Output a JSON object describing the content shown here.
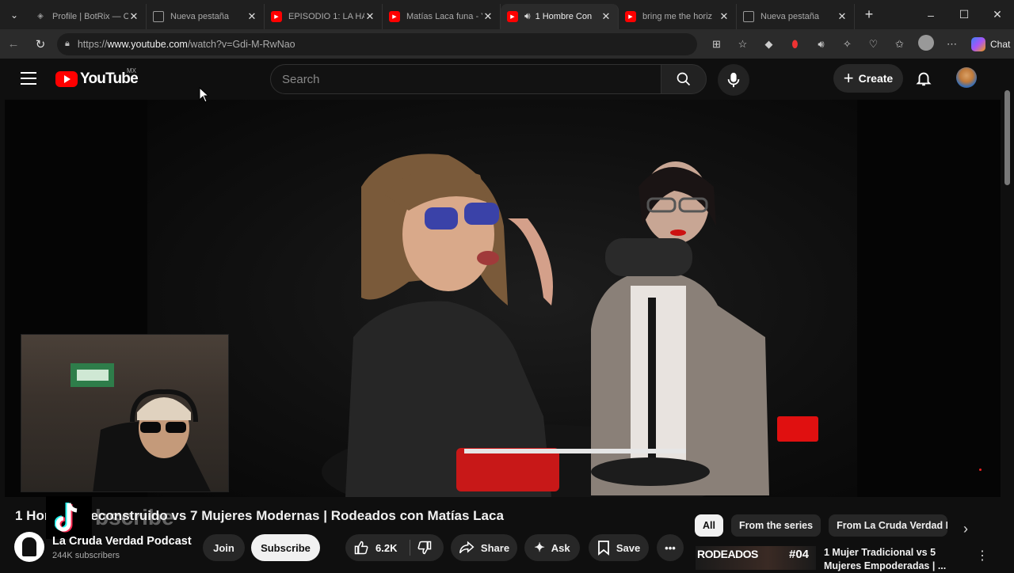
{
  "browser": {
    "tabs": [
      {
        "label": "Profile | BotRix — C",
        "favicon": "shield-icon",
        "active": false
      },
      {
        "label": "Nueva pestaña",
        "favicon": "page-icon",
        "active": false
      },
      {
        "label": "EPISODIO 1: LA HA",
        "favicon": "youtube-icon",
        "active": false
      },
      {
        "label": "Matías Laca funa - Y",
        "favicon": "youtube-icon",
        "active": false
      },
      {
        "label": "1 Hombre Con",
        "favicon": "youtube-icon",
        "active": true,
        "audio": true
      },
      {
        "label": "bring me the horiz",
        "favicon": "youtube-icon",
        "active": false
      },
      {
        "label": "Nueva pestaña",
        "favicon": "page-icon",
        "active": false
      }
    ],
    "url_prefix": "https://",
    "url_host": "www.youtube.com",
    "url_path": "/watch?v=Gdi-M-RwNao",
    "chat_label": "Chat"
  },
  "youtube": {
    "logo_text": "YouTube",
    "country": "MX",
    "search_placeholder": "Search",
    "create_label": "Create"
  },
  "video": {
    "title": "1 Hombre Deconstruido vs 7 Mujeres Modernas | Rodeados con Matías Laca",
    "overlay_text": "bscribe"
  },
  "channel": {
    "name": "La Cruda Verdad Podcast",
    "subscribers": "244K subscribers",
    "join_label": "Join",
    "subscribe_label": "Subscribe"
  },
  "actions": {
    "likes": "6.2K",
    "share_label": "Share",
    "ask_label": "Ask",
    "save_label": "Save"
  },
  "chips": [
    "All",
    "From the series",
    "From La Cruda Verdad Podcast"
  ],
  "recommendation": {
    "thumb_brand": "RODEADOS",
    "thumb_number": "#04",
    "title": "1 Mujer Tradicional vs 5 Mujeres Empoderadas | ..."
  },
  "colors": {
    "brand": "#ff0000",
    "background": "#0f0f0f"
  }
}
